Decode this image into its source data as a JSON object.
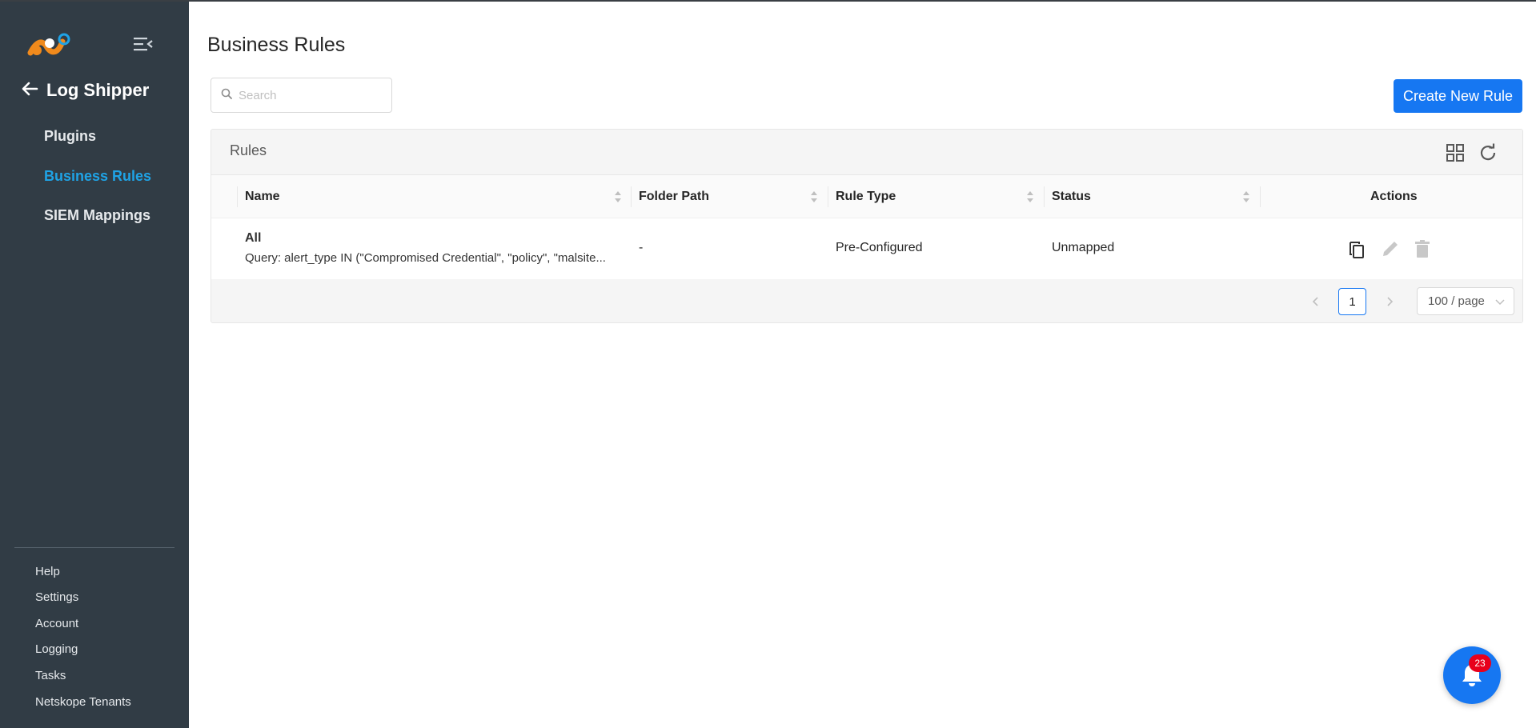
{
  "sidebar": {
    "app_title": "Log Shipper",
    "nav_items": [
      {
        "label": "Plugins",
        "active": false
      },
      {
        "label": "Business Rules",
        "active": true
      },
      {
        "label": "SIEM Mappings",
        "active": false
      }
    ],
    "footer_items": [
      {
        "label": "Help"
      },
      {
        "label": "Settings"
      },
      {
        "label": "Account"
      },
      {
        "label": "Logging"
      },
      {
        "label": "Tasks"
      },
      {
        "label": "Netskope Tenants"
      }
    ],
    "active_color": "#1fa3e6",
    "background_color": "#313c45"
  },
  "page": {
    "title": "Business Rules",
    "search_placeholder": "Search",
    "search_value": "",
    "create_button_label": "Create New Rule",
    "accent_color": "#1677f2"
  },
  "rules_card": {
    "title": "Rules",
    "header_icons": [
      "grid-view-icon",
      "refresh-icon"
    ],
    "columns": [
      {
        "label": "Name",
        "sortable": true
      },
      {
        "label": "Folder Path",
        "sortable": true
      },
      {
        "label": "Rule Type",
        "sortable": true
      },
      {
        "label": "Status",
        "sortable": true
      },
      {
        "label": "Actions",
        "sortable": false
      }
    ],
    "rows": [
      {
        "name": "All",
        "query": "Query: alert_type IN (\"Compromised Credential\", \"policy\", \"malsite...",
        "folder_path": "-",
        "rule_type": "Pre-Configured",
        "status": "Unmapped",
        "actions": [
          "copy-icon",
          "edit-icon",
          "delete-icon"
        ]
      }
    ],
    "pagination": {
      "current_page": "1",
      "page_size_label": "100 / page"
    }
  },
  "notifications": {
    "count": "23",
    "icon": "bell-icon",
    "badge_color": "#e8001c"
  }
}
